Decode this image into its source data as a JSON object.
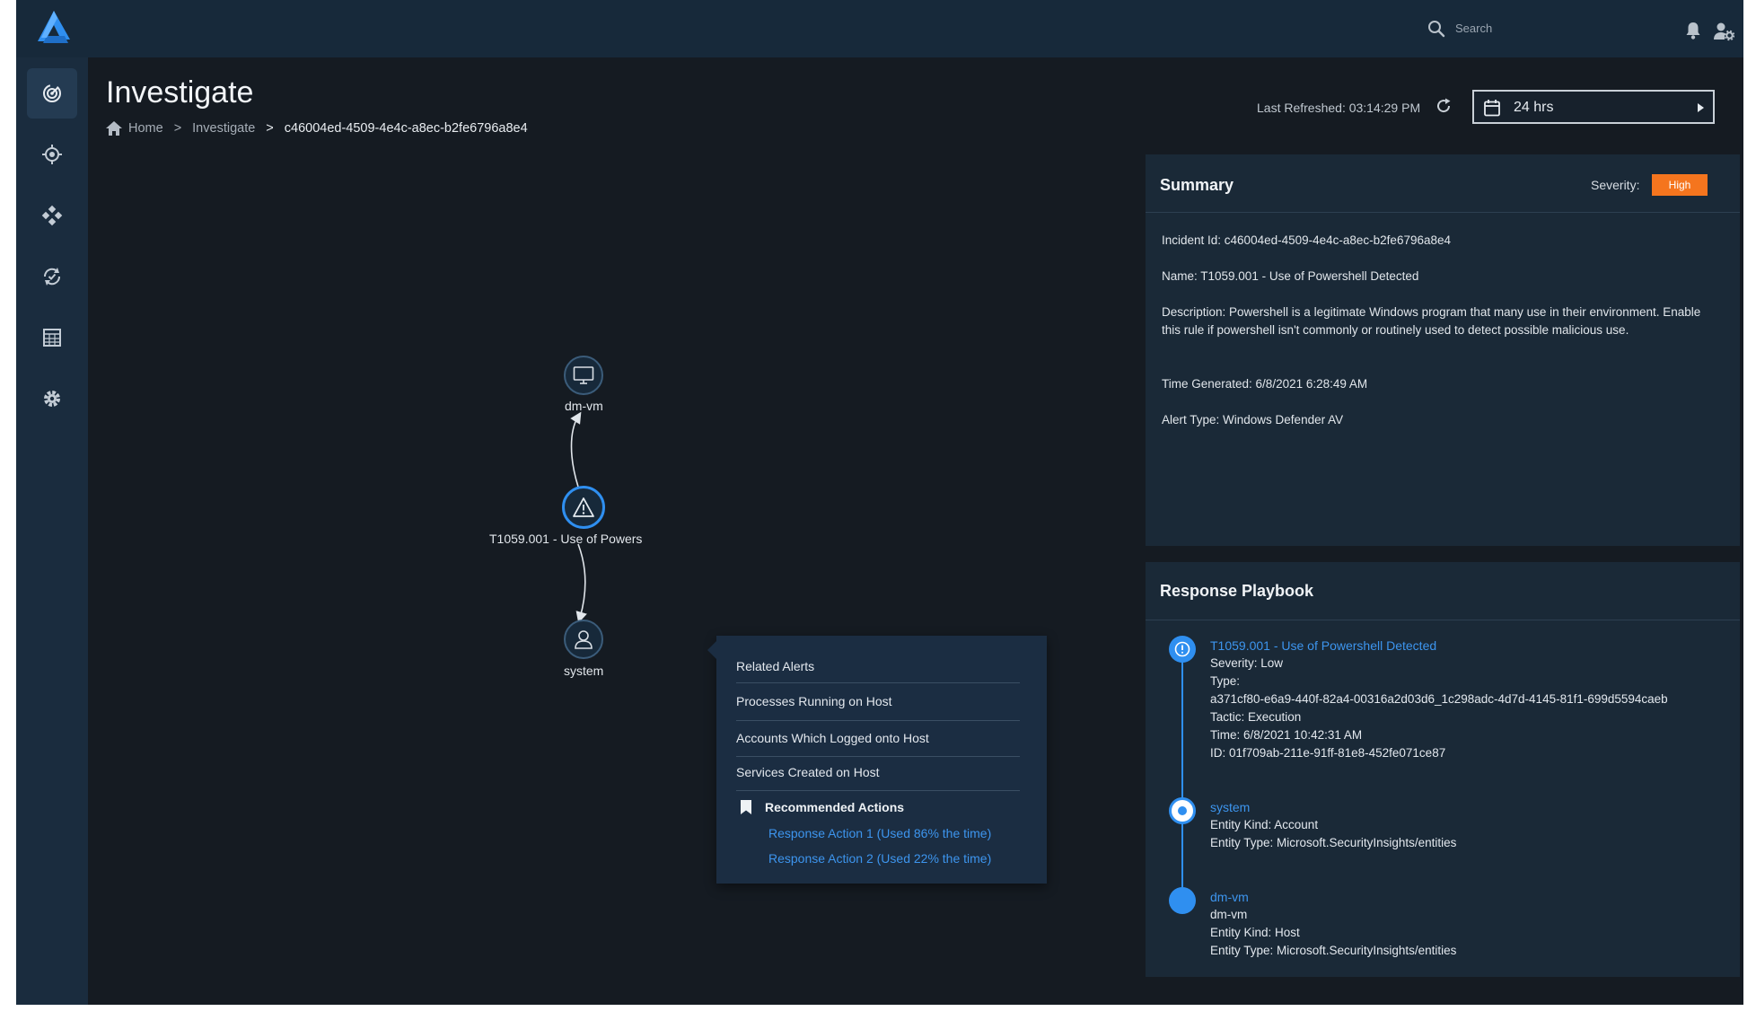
{
  "search": {
    "placeholder": "Search"
  },
  "sidebar": {
    "items": [
      {
        "name": "dashboard",
        "icon": "radar-icon",
        "active": true
      },
      {
        "name": "detect",
        "icon": "target-icon"
      },
      {
        "name": "network",
        "icon": "network-icon"
      },
      {
        "name": "respond",
        "icon": "shield-refresh-icon"
      },
      {
        "name": "reports",
        "icon": "grid-report-icon"
      },
      {
        "name": "settings",
        "icon": "gear-icon"
      }
    ]
  },
  "page": {
    "title": "Investigate",
    "breadcrumb": {
      "home": "Home",
      "investigate": "Investigate",
      "current": "c46004ed-4509-4e4c-a8ec-b2fe6796a8e4",
      "sep": ">"
    },
    "last_refreshed": "Last Refreshed: 03:14:29 PM",
    "time_range": "24 hrs"
  },
  "graph": {
    "nodes": [
      {
        "id": "dm-vm",
        "label": "dm-vm",
        "icon": "monitor-icon"
      },
      {
        "id": "alert",
        "label": "T1059.001 - Use of Powers",
        "icon": "warning-icon"
      },
      {
        "id": "system",
        "label": "system",
        "icon": "user-icon"
      }
    ],
    "menu": {
      "items": [
        "Related Alerts",
        "Processes Running on Host",
        "Accounts Which Logged onto Host",
        "Services Created on Host"
      ],
      "recommended_title": "Recommended Actions",
      "actions": [
        "Response Action 1 (Used 86% the time)",
        "Response Action 2 (Used 22% the time)"
      ]
    }
  },
  "summary": {
    "title": "Summary",
    "severity_label": "Severity:",
    "severity": "High",
    "severity_color": "#f5751e",
    "incident_id": "Incident Id: c46004ed-4509-4e4c-a8ec-b2fe6796a8e4",
    "name": "Name: T1059.001 - Use of Powershell Detected",
    "description": "Description: Powershell is a legitimate Windows program that many use in their environment. Enable this rule if powershell isn't commonly or routinely used to detect possible malicious use.",
    "time_generated": "Time Generated: 6/8/2021 6:28:49 AM",
    "alert_type": "Alert Type: Windows Defender AV"
  },
  "playbook": {
    "title": "Response Playbook",
    "accent": "#2f8ff0",
    "steps": [
      {
        "title": "T1059.001 - Use of Powershell Detected",
        "lines": [
          "Severity: Low",
          "Type:",
          "a371cf80-e6a9-440f-82a4-00316a2d03d6_1c298adc-4d7d-4145-81f1-699d5594caeb",
          "Tactic: Execution",
          "Time: 6/8/2021 10:42:31 AM",
          "ID: 01f709ab-211e-91ff-81e8-452fe071ce87"
        ]
      },
      {
        "title": "system",
        "lines": [
          "Entity Kind: Account",
          "Entity Type: Microsoft.SecurityInsights/entities"
        ]
      },
      {
        "title": "dm-vm",
        "lines": [
          "dm-vm",
          "Entity Kind: Host",
          "Entity Type: Microsoft.SecurityInsights/entities"
        ]
      }
    ]
  }
}
